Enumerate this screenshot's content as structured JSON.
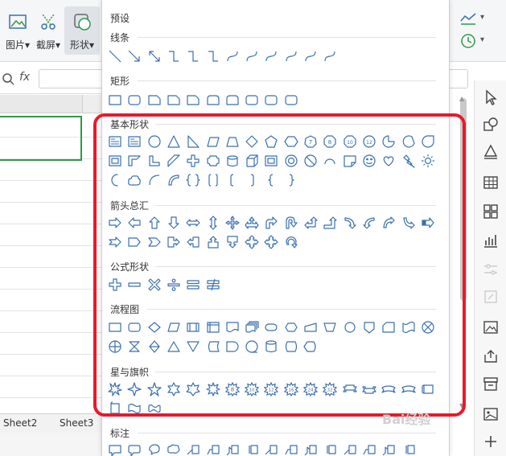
{
  "ribbon": {
    "picture_label": "图片",
    "screenshot_label": "截屏",
    "shape_label": "形状",
    "formula_fx": "fx"
  },
  "sheets": [
    "Sheet2",
    "Sheet3"
  ],
  "panel": {
    "header": "预设",
    "sections": {
      "lines": "线条",
      "rect": "矩形",
      "basic": "基本形状",
      "arrows": "箭头总汇",
      "formula": "公式形状",
      "flowchart": "流程图",
      "stars": "星与旗帜",
      "callouts": "标注"
    }
  },
  "colors": {
    "shape_stroke": "#3a6fb0",
    "highlight": "#e8192c",
    "selection": "#2e9a47"
  },
  "watermark": "Bai经验"
}
